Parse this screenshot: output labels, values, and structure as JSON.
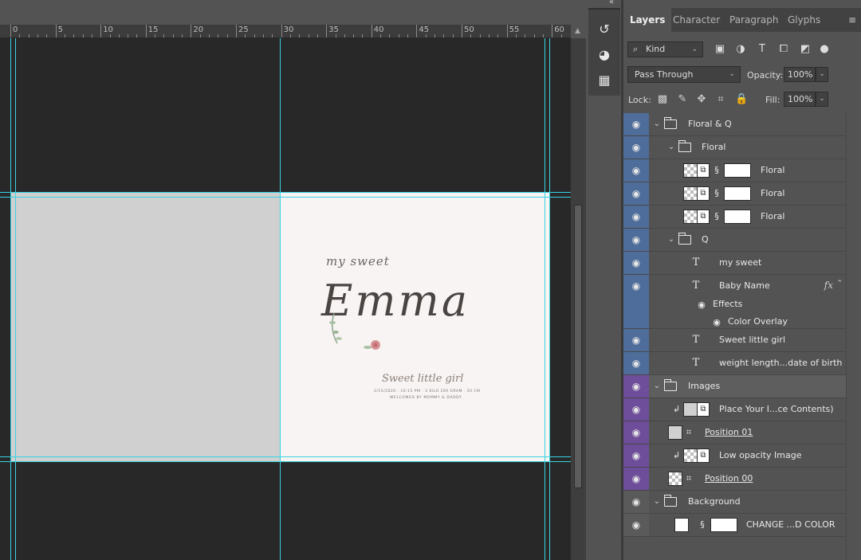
{
  "ruler": {
    "labels": [
      "0",
      "5",
      "10",
      "15",
      "20",
      "25",
      "30",
      "35",
      "40",
      "45",
      "50",
      "55",
      "60"
    ]
  },
  "card": {
    "my_sweet": "my sweet",
    "name": "Emma",
    "tagline": "Sweet little girl",
    "details": "2/15/2020 · 10:15 PM · 3 KILO 200 GRAM · 50 CM",
    "welcome": "WELCOMED BY MOMMY & DADDY"
  },
  "panel": {
    "tabs": [
      "Layers",
      "Character",
      "Paragraph",
      "Glyphs"
    ],
    "active_tab": "Layers",
    "kind_label": "Kind",
    "blend_mode": "Pass Through",
    "opacity_label": "Opacity:",
    "opacity_value": "100%",
    "lock_label": "Lock:",
    "fill_label": "Fill:",
    "fill_value": "100%"
  },
  "layers": [
    {
      "name": "Floral & Q",
      "kind": "group",
      "label_color": "#4f6d9a"
    },
    {
      "name": "Floral",
      "kind": "group",
      "label_color": "#4f6d9a"
    },
    {
      "name": "Floral",
      "kind": "smart-masked",
      "label_color": "#4f6d9a"
    },
    {
      "name": "Floral",
      "kind": "smart-masked",
      "label_color": "#4f6d9a"
    },
    {
      "name": "Floral",
      "kind": "smart-masked",
      "label_color": "#4f6d9a"
    },
    {
      "name": "Q",
      "kind": "group",
      "label_color": "#4f6d9a"
    },
    {
      "name": "my sweet",
      "kind": "text",
      "label_color": "#4f6d9a"
    },
    {
      "name": "Baby Name",
      "kind": "text-fx",
      "label_color": "#4f6d9a",
      "effects_label": "Effects",
      "effect": "Color Overlay"
    },
    {
      "name": "Sweet little girl",
      "kind": "text",
      "label_color": "#4f6d9a"
    },
    {
      "name": "weight length...date of birth",
      "kind": "text",
      "label_color": "#4f6d9a"
    },
    {
      "name": "Images",
      "kind": "group",
      "label_color": "#6e4e9a"
    },
    {
      "name": "Place Your I...ce Contents)",
      "kind": "smart-clipped",
      "label_color": "#6e4e9a"
    },
    {
      "name": "Position 01",
      "kind": "frame",
      "label_color": "#6e4e9a"
    },
    {
      "name": "Low opacity Image",
      "kind": "smart-clipped",
      "label_color": "#6e4e9a"
    },
    {
      "name": "Position 00",
      "kind": "frame",
      "label_color": "#6e4e9a"
    },
    {
      "name": "Background",
      "kind": "group",
      "label_color": "#5a5a5a"
    },
    {
      "name": "CHANGE ...D COLOR",
      "kind": "fill-masked",
      "label_color": "#5a5a5a"
    }
  ],
  "colors": {
    "accent_guides": "#37d3e3",
    "label_blue": "#4f6d9a",
    "label_violet": "#6e4e9a",
    "label_gray": "#5a5a5a"
  }
}
